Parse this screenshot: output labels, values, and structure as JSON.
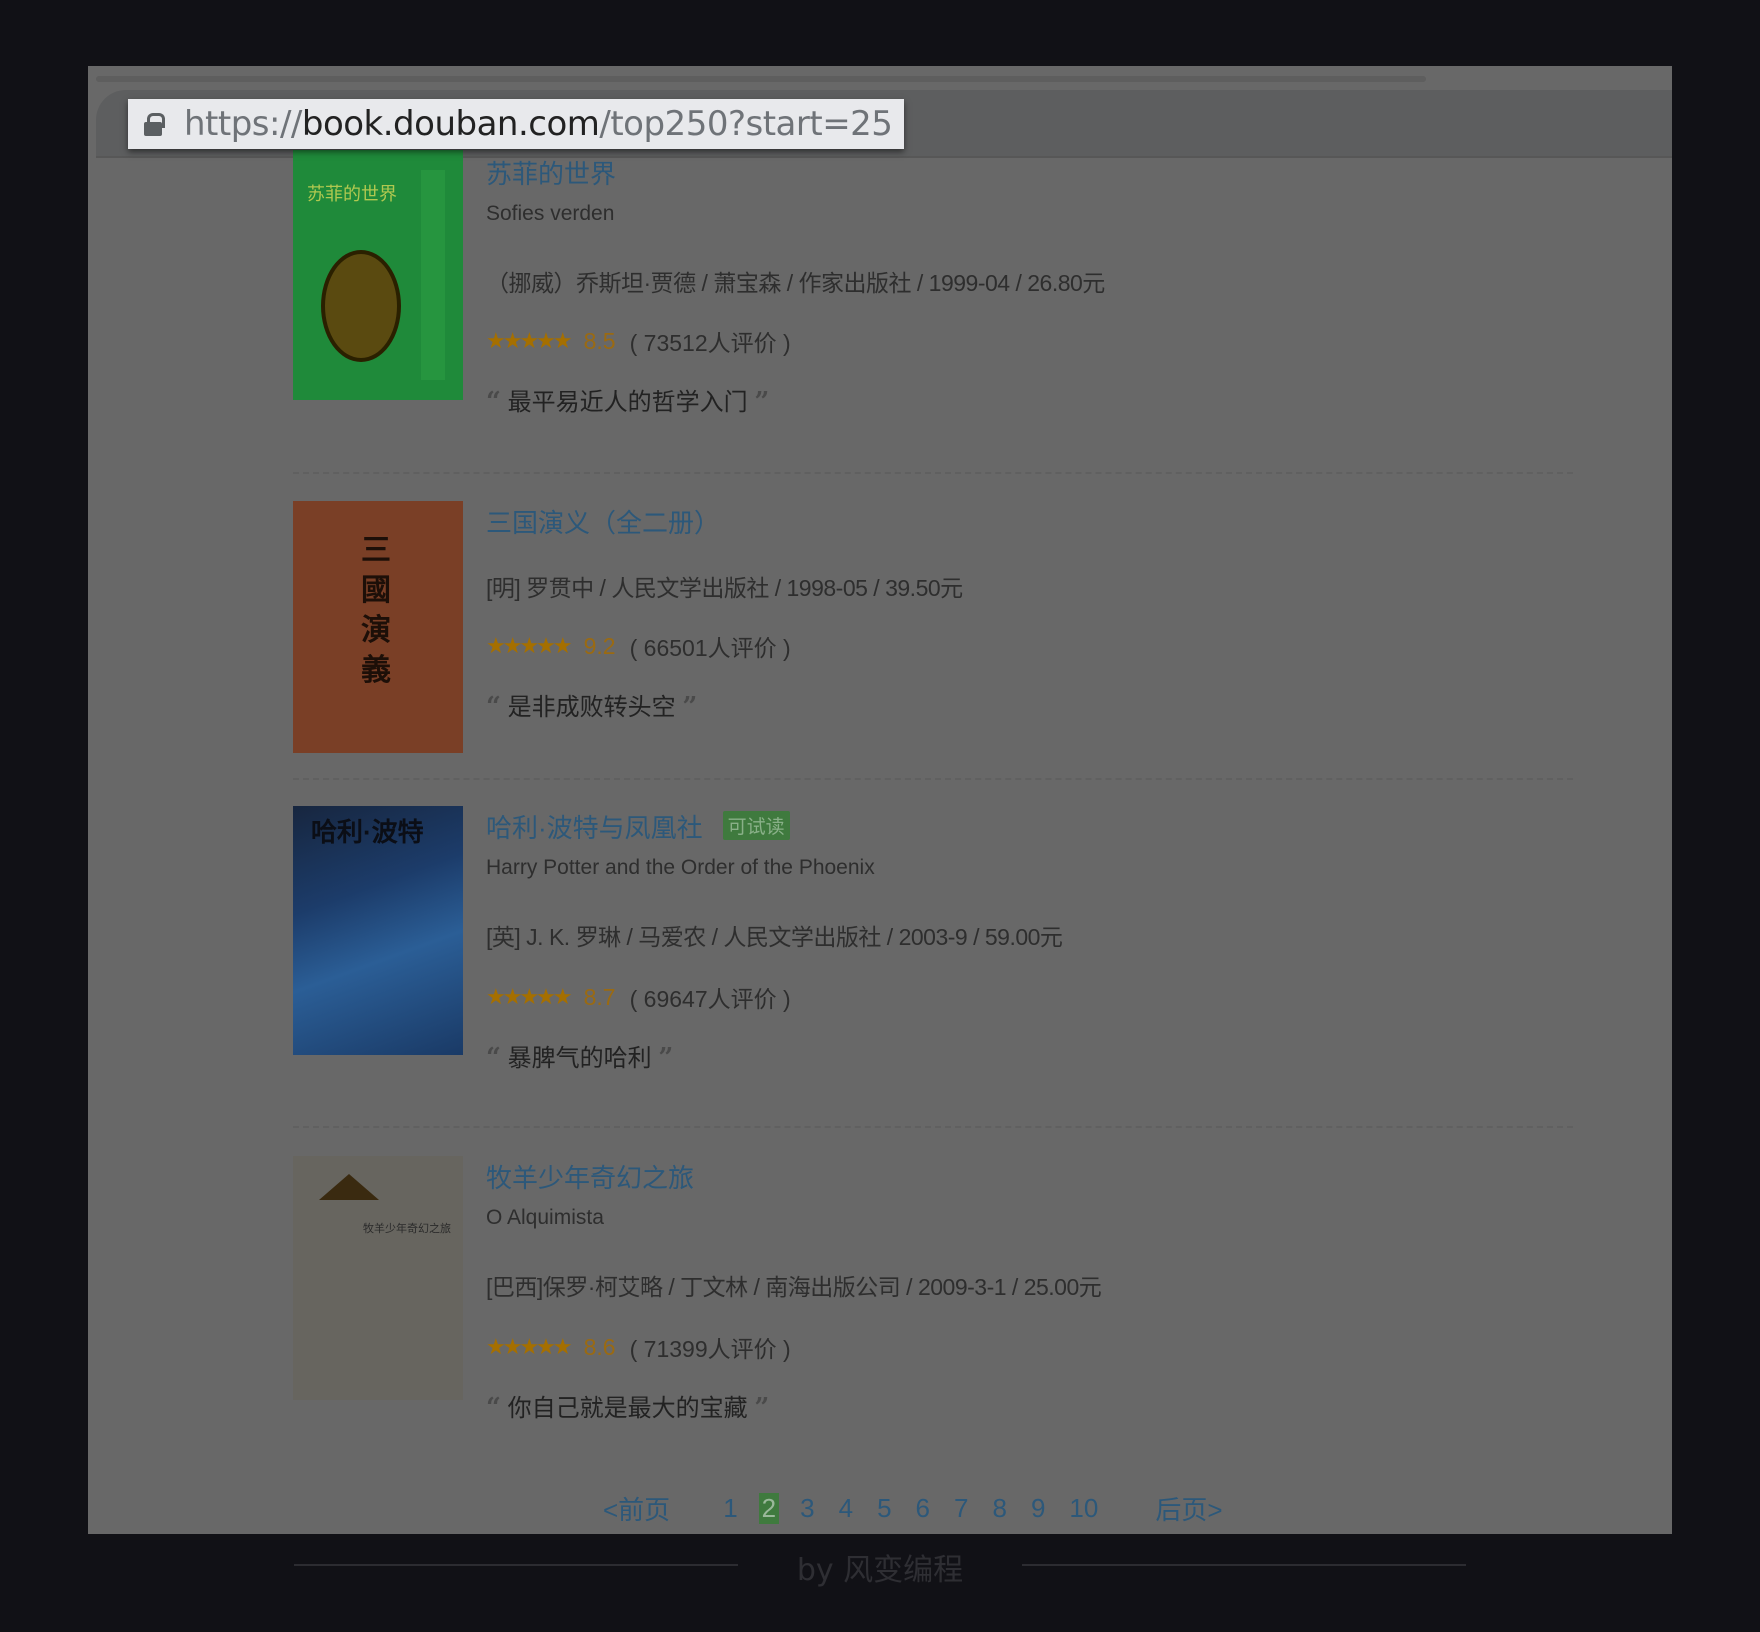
{
  "browser": {
    "url_host_prefix": "https://",
    "url_host": "book.douban.com",
    "url_path": "/top250?start=25"
  },
  "books": [
    {
      "title": "苏菲的世界",
      "subtitle": "Sofies verden",
      "info": "（挪威）乔斯坦·贾德 / 萧宝森 / 作家出版社 / 1999-04 / 26.80元",
      "stars": "★★★★★",
      "score": "8.5",
      "count": "( 73512人评价 )",
      "quote": "最平易近人的哲学入门",
      "cover_text": "苏菲的世界",
      "cover_color": "#1f8a3a"
    },
    {
      "title": "三国演义（全二册）",
      "info": "[明] 罗贯中 / 人民文学出版社 / 1998-05 / 39.50元",
      "stars": "★★★★★",
      "score": "9.2",
      "count": "( 66501人评价 )",
      "quote": "是非成败转头空",
      "cover_text": "三國演義",
      "cover_color": "#7a3f26"
    },
    {
      "title": "哈利·波特与凤凰社",
      "badge": "可试读",
      "subtitle": "Harry Potter and the Order of the Phoenix",
      "info": "[英] J. K. 罗琳 / 马爱农 / 人民文学出版社 / 2003-9 / 59.00元",
      "stars": "★★★★★",
      "score": "8.7",
      "count": "( 69647人评价 )",
      "quote": "暴脾气的哈利",
      "cover_text": "哈利·波特",
      "cover_color": "#1c3c6a"
    },
    {
      "title": "牧羊少年奇幻之旅",
      "subtitle": "O Alquimista",
      "info": "[巴西]保罗·柯艾略 / 丁文林 / 南海出版公司 / 2009-3-1 / 25.00元",
      "stars": "★★★★★",
      "score": "8.6",
      "count": "( 71399人评价 )",
      "quote": "你自己就是最大的宝藏",
      "cover_text": "牧羊少年奇幻之旅",
      "cover_color": "#67655f"
    }
  ],
  "quote_open": "“",
  "quote_close": "”",
  "pagination": {
    "prev": "<前页",
    "pages": [
      "1",
      "2",
      "3",
      "4",
      "5",
      "6",
      "7",
      "8",
      "9",
      "10"
    ],
    "current": "2",
    "next": "后页>"
  },
  "footer": "by 风变编程"
}
